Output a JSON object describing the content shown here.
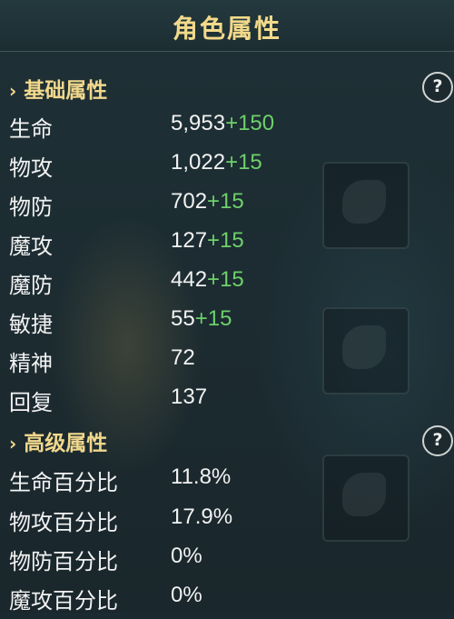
{
  "header": {
    "title": "角色属性"
  },
  "basic": {
    "title": "基础属性",
    "help": "?",
    "stats": [
      {
        "name": "生命",
        "value": "5,953",
        "bonus": "+150"
      },
      {
        "name": "物攻",
        "value": "1,022",
        "bonus": "+15"
      },
      {
        "name": "物防",
        "value": "702",
        "bonus": "+15"
      },
      {
        "name": "魔攻",
        "value": "127",
        "bonus": "+15"
      },
      {
        "name": "魔防",
        "value": "442",
        "bonus": "+15"
      },
      {
        "name": "敏捷",
        "value": "55",
        "bonus": "+15"
      },
      {
        "name": "精神",
        "value": "72",
        "bonus": ""
      },
      {
        "name": "回复",
        "value": "137",
        "bonus": ""
      }
    ]
  },
  "advanced": {
    "title": "高级属性",
    "help": "?",
    "stats": [
      {
        "name": "生命百分比",
        "value": "11.8%"
      },
      {
        "name": "物攻百分比",
        "value": "17.9%"
      },
      {
        "name": "物防百分比",
        "value": "0%"
      },
      {
        "name": "魔攻百分比",
        "value": "0%"
      }
    ]
  },
  "colors": {
    "title": "#f2d98a",
    "bonus": "#6ed06a",
    "text": "#f2f2f2"
  }
}
